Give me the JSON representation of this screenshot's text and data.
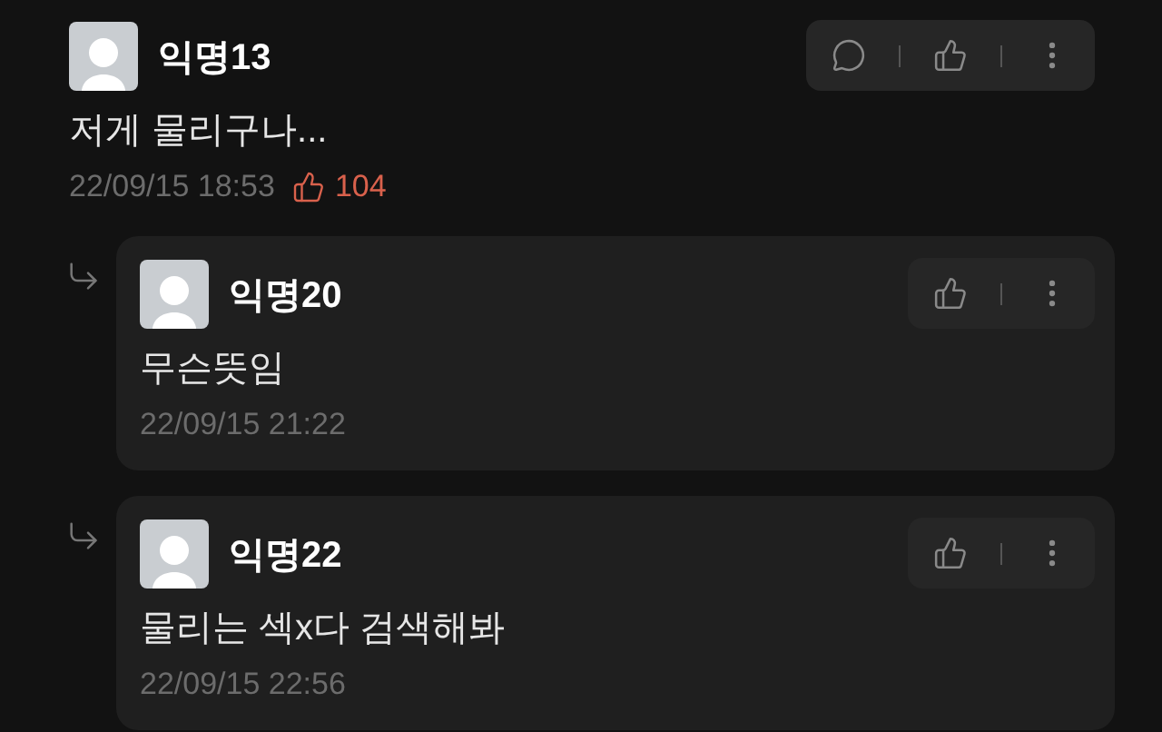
{
  "comments": [
    {
      "kind": "comment",
      "author": "익명13",
      "text": "저게 물리구나...",
      "time": "22/09/15 18:53",
      "likes": "104"
    },
    {
      "kind": "reply",
      "author": "익명20",
      "text": "무슨뜻임",
      "time": "22/09/15 21:22"
    },
    {
      "kind": "reply",
      "author": "익명22",
      "text": "물리는 섹x다 검색해봐",
      "time": "22/09/15 22:56"
    }
  ]
}
